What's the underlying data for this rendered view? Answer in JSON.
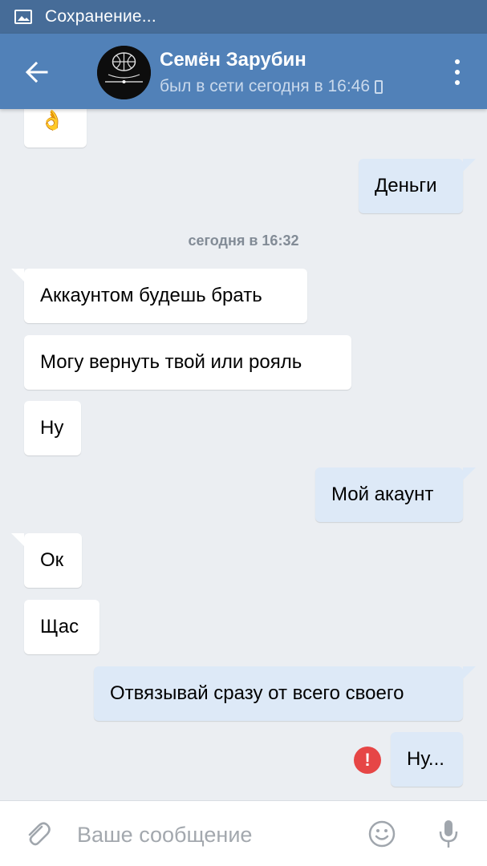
{
  "status_bar": {
    "text": "Сохранение..."
  },
  "header": {
    "name": "Семён Зарубин",
    "status": "был в сети сегодня в 16:46"
  },
  "chat": {
    "date_separator": "сегодня в 16:32",
    "messages": [
      {
        "dir": "in",
        "text": "👌"
      },
      {
        "dir": "out",
        "text": "Деньги"
      },
      {
        "dir": "in",
        "text": "Аккаунтом будешь брать"
      },
      {
        "dir": "in",
        "text": "Могу вернуть твой или рояль"
      },
      {
        "dir": "in",
        "text": "Ну"
      },
      {
        "dir": "out",
        "text": "Мой акаунт"
      },
      {
        "dir": "in",
        "text": "Ок"
      },
      {
        "dir": "in",
        "text": "Щас"
      },
      {
        "dir": "out",
        "text": "Отвязывай сразу от всего своего"
      },
      {
        "dir": "out",
        "text": "Ну...",
        "error": true
      }
    ],
    "error_mark": "!"
  },
  "input": {
    "placeholder": "Ваше сообщение"
  },
  "colors": {
    "header": "#5181b8",
    "status_bar": "#466c98",
    "chat_bg": "#ebeef2",
    "incoming": "#ffffff",
    "outgoing": "#dde9f7",
    "error": "#e64646"
  },
  "icons": [
    "image-icon",
    "back-arrow-icon",
    "phone-icon",
    "more-vertical-icon",
    "error-icon",
    "attach-icon",
    "emoji-icon",
    "microphone-icon"
  ]
}
